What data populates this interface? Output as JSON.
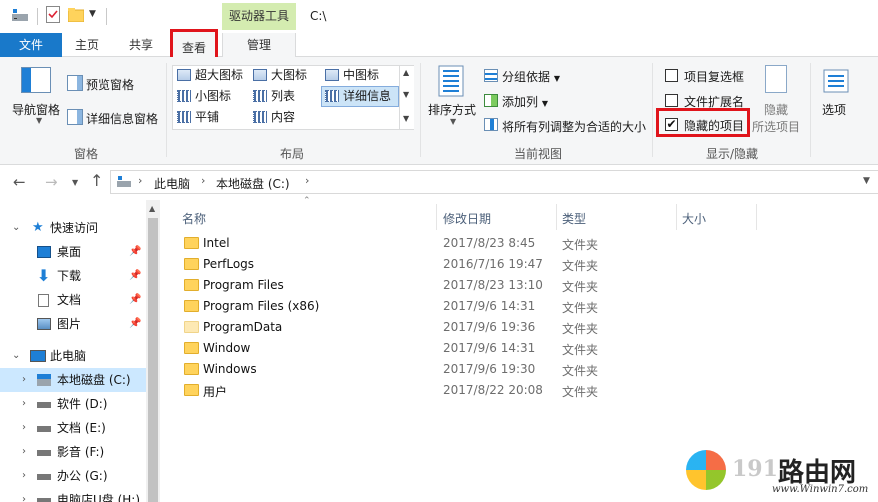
{
  "title_bar": {
    "context_tab_header": "驱动器工具",
    "window_title": "C:\\"
  },
  "ribbon_tabs": {
    "file": "文件",
    "home": "主页",
    "share": "共享",
    "view": "查看",
    "manage": "管理"
  },
  "ribbon": {
    "panes": {
      "navigation_pane": "导航窗格",
      "preview_pane": "预览窗格",
      "details_pane": "详细信息窗格",
      "group_label": "窗格"
    },
    "layout": {
      "items": [
        "超大图标",
        "大图标",
        "中图标",
        "小图标",
        "列表",
        "详细信息",
        "平铺",
        "内容"
      ],
      "selected": "详细信息",
      "group_label": "布局"
    },
    "current_view": {
      "sort_by": "排序方式",
      "group_by": "分组依据",
      "add_columns": "添加列",
      "fit_columns": "将所有列调整为合适的大小",
      "group_label": "当前视图"
    },
    "show_hide": {
      "item_checkboxes": "项目复选框",
      "item_checkboxes_checked": false,
      "file_extensions": "文件扩展名",
      "file_extensions_checked": false,
      "hidden_items": "隐藏的项目",
      "hidden_items_checked": true,
      "hide_selected_1": "隐藏",
      "hide_selected_2": "所选项目",
      "group_label": "显示/隐藏"
    },
    "options": "选项"
  },
  "address_bar": {
    "crumbs": [
      "此电脑",
      "本地磁盘 (C:)"
    ]
  },
  "nav_pane": {
    "quick_access": "快速访问",
    "quick_items": [
      "桌面",
      "下载",
      "文档",
      "图片"
    ],
    "this_pc": "此电脑",
    "drives": [
      "本地磁盘 (C:)",
      "软件 (D:)",
      "文档 (E:)",
      "影音 (F:)",
      "办公 (G:)",
      "电脑店U盘 (H:)"
    ],
    "selected": "本地磁盘 (C:)"
  },
  "file_list": {
    "columns": [
      "名称",
      "修改日期",
      "类型",
      "大小"
    ],
    "rows": [
      {
        "name": "Intel",
        "date": "2017/8/23 8:45",
        "type": "文件夹"
      },
      {
        "name": "PerfLogs",
        "date": "2016/7/16 19:47",
        "type": "文件夹"
      },
      {
        "name": "Program Files",
        "date": "2017/8/23 13:10",
        "type": "文件夹"
      },
      {
        "name": "Program Files (x86)",
        "date": "2017/9/6 14:31",
        "type": "文件夹"
      },
      {
        "name": "ProgramData",
        "date": "2017/9/6 19:36",
        "type": "文件夹",
        "hidden": true
      },
      {
        "name": "Window",
        "date": "2017/9/6 14:31",
        "type": "文件夹"
      },
      {
        "name": "Windows",
        "date": "2017/9/6 19:30",
        "type": "文件夹"
      },
      {
        "name": "用户",
        "date": "2017/8/22 20:08",
        "type": "文件夹"
      }
    ]
  },
  "watermark": {
    "brand_1": "191",
    "brand_2": "路由网",
    "url": "www.Winwin7.com"
  },
  "colors": {
    "file_tab": "#1979ca",
    "context_tab": "#d4ecb0",
    "highlight_frame": "#e0141b",
    "selection": "#cce8ff",
    "folder": "#ffd35c"
  }
}
